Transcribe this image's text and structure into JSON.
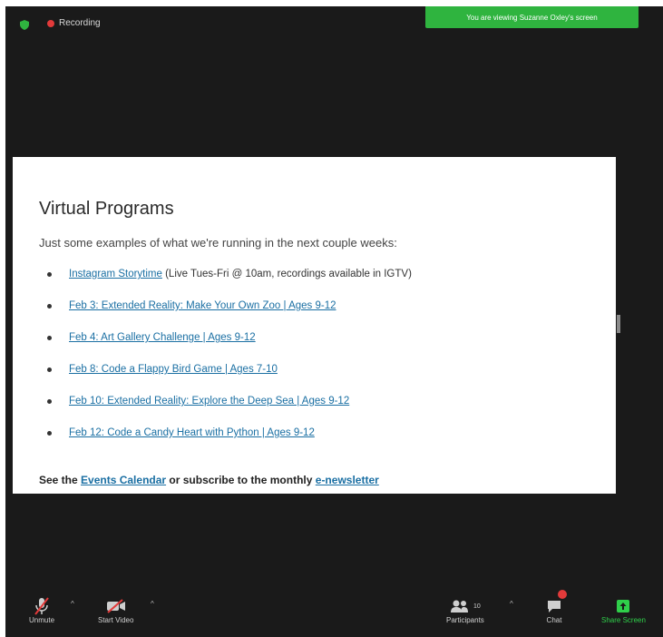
{
  "topbar": {
    "recording_label": "Recording",
    "viewing_banner": "You are viewing Suzanne Oxley's screen"
  },
  "slide": {
    "title": "Virtual Programs",
    "subtitle": "Just some examples of what we're running in the next couple weeks:",
    "items": [
      {
        "link": "Instagram Storytime",
        "rest": " (Live Tues-Fri @ 10am, recordings available in IGTV)"
      },
      {
        "link": "Feb 3: Extended Reality: Make Your Own Zoo | Ages 9-12",
        "rest": ""
      },
      {
        "link": "Feb 4: Art Gallery Challenge | Ages 9-12",
        "rest": ""
      },
      {
        "link": "Feb 8: Code a Flappy Bird Game | Ages 7-10",
        "rest": ""
      },
      {
        "link": "Feb 10: Extended Reality: Explore the Deep Sea | Ages 9-12",
        "rest": ""
      },
      {
        "link": "Feb 12: Code a Candy Heart with Python | Ages 9-12",
        "rest": ""
      }
    ],
    "footer": {
      "prefix": "See the ",
      "calendar_link": "Events Calendar",
      "middle": " or subscribe to the monthly ",
      "newsletter_link": "e-newsletter"
    }
  },
  "toolbar": {
    "unmute": "Unmute",
    "start_video": "Start Video",
    "participants": "Participants",
    "participants_count": "10",
    "chat": "Chat",
    "share_screen": "Share Screen"
  },
  "colors": {
    "background": "#1a1a1a",
    "accent_green": "#2fb43f",
    "link_blue": "#1a6fa3",
    "record_red": "#e23a3a"
  },
  "icons": [
    "shield-icon",
    "recording-icon",
    "mic-muted-icon",
    "video-off-icon",
    "participants-icon",
    "chat-icon",
    "share-screen-icon"
  ]
}
